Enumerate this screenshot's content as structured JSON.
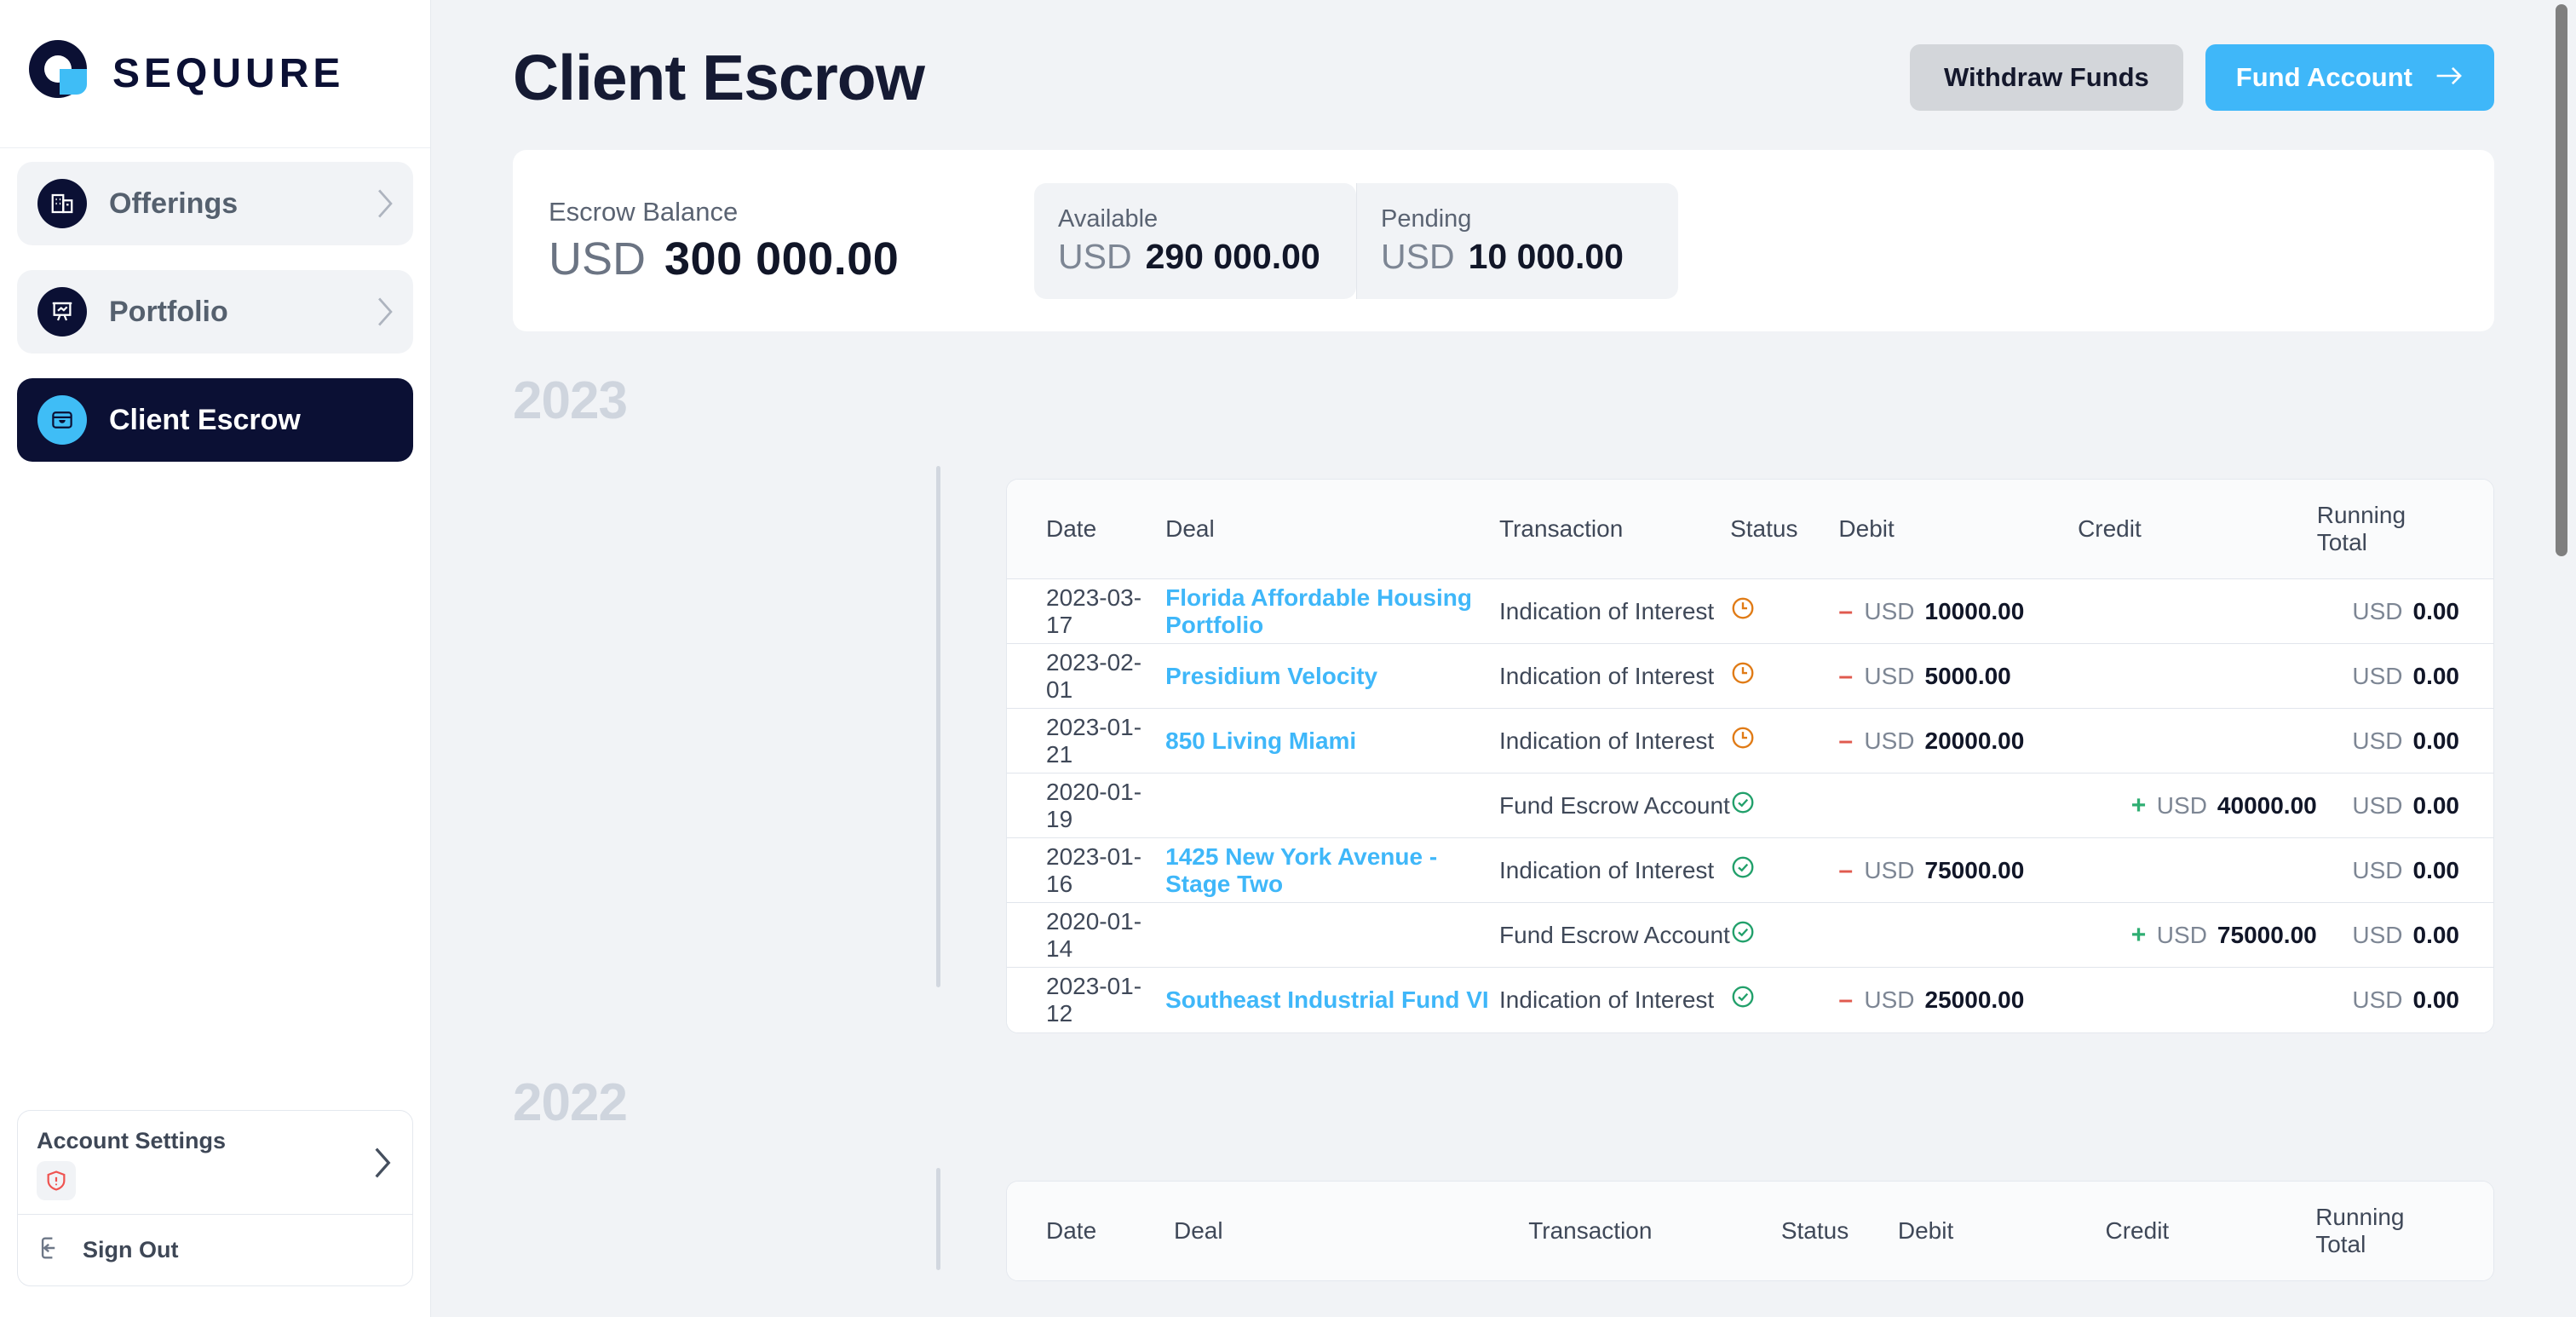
{
  "brand": {
    "name": "SEQUURE",
    "logo_icon": "sequure-logo-icon",
    "navy": "#0b1034",
    "blue": "#3fbdf6"
  },
  "sidebar": {
    "items": [
      {
        "label": "Offerings",
        "icon": "building-icon",
        "active": false,
        "chevron": "chevron-right-icon"
      },
      {
        "label": "Portfolio",
        "icon": "presentation-chart-icon",
        "active": false,
        "chevron": "chevron-right-icon"
      },
      {
        "label": "Client Escrow",
        "icon": "inbox-icon",
        "active": true,
        "chevron": "chevron-right-icon"
      }
    ],
    "account": {
      "title": "Account Settings",
      "alert_icon": "shield-alert-icon",
      "chevron": "chevron-right-icon",
      "signout_label": "Sign Out",
      "signout_icon": "logout-icon"
    }
  },
  "header": {
    "title": "Client Escrow",
    "withdraw_label": "Withdraw Funds",
    "fund_label": "Fund Account",
    "fund_arrow_icon": "arrow-right-icon"
  },
  "balance": {
    "label": "Escrow Balance",
    "currency": "USD",
    "amount": "300 000.00",
    "available": {
      "label": "Available",
      "currency": "USD",
      "amount": "290 000.00"
    },
    "pending": {
      "label": "Pending",
      "currency": "USD",
      "amount": "10 000.00"
    }
  },
  "table": {
    "columns": [
      "Date",
      "Deal",
      "Transaction",
      "Status",
      "Debit",
      "Credit",
      "Running Total"
    ],
    "currency": "USD"
  },
  "sections": [
    {
      "year": "2023",
      "rows": [
        {
          "date": "2023-03-17",
          "deal": "Florida Affordable Housing Portfolio",
          "transaction": "Indication of Interest",
          "status": "pending",
          "status_icon": "clock-icon",
          "debit_sign": "–",
          "debit_cur": "USD",
          "debit": "10000.00",
          "credit_sign": "",
          "credit_cur": "",
          "credit": "",
          "total_cur": "USD",
          "total": "0.00"
        },
        {
          "date": "2023-02-01",
          "deal": "Presidium Velocity",
          "transaction": "Indication of Interest",
          "status": "pending",
          "status_icon": "clock-icon",
          "debit_sign": "–",
          "debit_cur": "USD",
          "debit": "5000.00",
          "credit_sign": "",
          "credit_cur": "",
          "credit": "",
          "total_cur": "USD",
          "total": "0.00"
        },
        {
          "date": "2023-01-21",
          "deal": "850 Living Miami",
          "transaction": "Indication of Interest",
          "status": "pending",
          "status_icon": "clock-icon",
          "debit_sign": "–",
          "debit_cur": "USD",
          "debit": "20000.00",
          "credit_sign": "",
          "credit_cur": "",
          "credit": "",
          "total_cur": "USD",
          "total": "0.00"
        },
        {
          "date": "2020-01-19",
          "deal": "",
          "transaction": "Fund Escrow Account",
          "status": "completed",
          "status_icon": "check-circle-icon",
          "debit_sign": "",
          "debit_cur": "",
          "debit": "",
          "credit_sign": "+",
          "credit_cur": "USD",
          "credit": "40000.00",
          "total_cur": "USD",
          "total": "0.00"
        },
        {
          "date": "2023-01-16",
          "deal": "1425 New York Avenue - Stage Two",
          "transaction": "Indication of Interest",
          "status": "completed",
          "status_icon": "check-circle-icon",
          "debit_sign": "–",
          "debit_cur": "USD",
          "debit": "75000.00",
          "credit_sign": "",
          "credit_cur": "",
          "credit": "",
          "total_cur": "USD",
          "total": "0.00"
        },
        {
          "date": "2020-01-14",
          "deal": "",
          "transaction": "Fund Escrow Account",
          "status": "completed",
          "status_icon": "check-circle-icon",
          "debit_sign": "",
          "debit_cur": "",
          "debit": "",
          "credit_sign": "+",
          "credit_cur": "USD",
          "credit": "75000.00",
          "total_cur": "USD",
          "total": "0.00"
        },
        {
          "date": "2023-01-12",
          "deal": "Southeast Industrial Fund VI",
          "transaction": "Indication of Interest",
          "status": "completed",
          "status_icon": "check-circle-icon",
          "debit_sign": "–",
          "debit_cur": "USD",
          "debit": "25000.00",
          "credit_sign": "",
          "credit_cur": "",
          "credit": "",
          "total_cur": "USD",
          "total": "0.00"
        }
      ]
    },
    {
      "year": "2022",
      "rows": []
    }
  ],
  "colors": {
    "accent_blue": "#3fb7f9",
    "navy": "#0b1034",
    "pending_orange": "#e07b16",
    "success_green": "#22a06b",
    "debit_red": "#e05a4e",
    "page_bg": "#f1f3f6"
  }
}
